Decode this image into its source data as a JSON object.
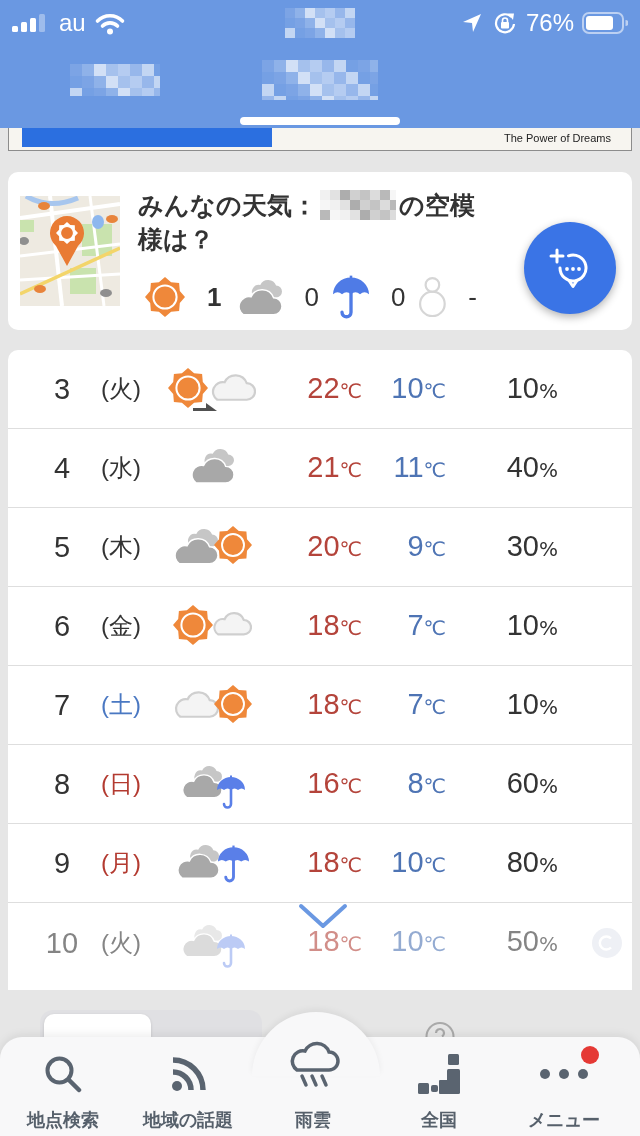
{
  "status_bar": {
    "carrier": "au",
    "battery": "76%"
  },
  "tabs": [
    {
      "selected": false
    },
    {
      "selected": true
    }
  ],
  "ad_banner": {
    "slogan": "The Power of Dreams"
  },
  "community_weather": {
    "title_start": "みんなの天気：",
    "title_end_lines": [
      "の空模",
      "様は？"
    ],
    "votes": [
      {
        "kind": "sunny",
        "count": "1",
        "leading": true
      },
      {
        "kind": "cloudy",
        "count": "0",
        "leading": false
      },
      {
        "kind": "rainy",
        "count": "0",
        "leading": false
      },
      {
        "kind": "snowy",
        "count": "-",
        "leading": false
      }
    ]
  },
  "forecast": {
    "collapsed": true,
    "rows": [
      {
        "date": "3",
        "weekday": "(火)",
        "color": "#333333",
        "kind": "sunny_then_cloudy",
        "high": {
          "value": "22",
          "unit": "℃"
        },
        "low": {
          "value": "10",
          "unit": "℃"
        },
        "precipitation": {
          "value": "10",
          "unit": "%"
        }
      },
      {
        "date": "4",
        "weekday": "(水)",
        "color": "#333333",
        "kind": "cloudy",
        "high": {
          "value": "21",
          "unit": "℃"
        },
        "low": {
          "value": "11",
          "unit": "℃"
        },
        "precipitation": {
          "value": "40",
          "unit": "%"
        }
      },
      {
        "date": "5",
        "weekday": "(木)",
        "color": "#333333",
        "kind": "cloudy_with_sun",
        "high": {
          "value": "20",
          "unit": "℃"
        },
        "low": {
          "value": "9",
          "unit": "℃"
        },
        "precipitation": {
          "value": "30",
          "unit": "%"
        }
      },
      {
        "date": "6",
        "weekday": "(金)",
        "color": "#333333",
        "kind": "sunny_with_clouds",
        "high": {
          "value": "18",
          "unit": "℃"
        },
        "low": {
          "value": "7",
          "unit": "℃"
        },
        "precipitation": {
          "value": "10",
          "unit": "%"
        }
      },
      {
        "date": "7",
        "weekday": "(土)",
        "color": "#4a78c2",
        "kind": "clouds_with_sun",
        "high": {
          "value": "18",
          "unit": "℃"
        },
        "low": {
          "value": "7",
          "unit": "℃"
        },
        "precipitation": {
          "value": "10",
          "unit": "%"
        }
      },
      {
        "date": "8",
        "weekday": "(日)",
        "color": "#b33a30",
        "kind": "cloudy_with_light_rain",
        "high": {
          "value": "16",
          "unit": "℃"
        },
        "low": {
          "value": "8",
          "unit": "℃"
        },
        "precipitation": {
          "value": "60",
          "unit": "%"
        }
      },
      {
        "date": "9",
        "weekday": "(月)",
        "color": "#b33a30",
        "kind": "cloudy_with_rain",
        "high": {
          "value": "18",
          "unit": "℃"
        },
        "low": {
          "value": "10",
          "unit": "℃"
        },
        "precipitation": {
          "value": "80",
          "unit": "%"
        }
      },
      {
        "date": "10",
        "weekday": "(火)",
        "color": "#858585",
        "kind": "cloudy_with_light_rain",
        "high": {
          "value": "18",
          "unit": "℃"
        },
        "low": {
          "value": "10",
          "unit": "℃"
        },
        "precipitation": {
          "value": "50",
          "unit": "%"
        }
      }
    ]
  },
  "range_tabs": [
    {
      "selected": true
    },
    {
      "selected": false
    }
  ],
  "nav": [
    {
      "kind": "search",
      "label": "地点検索",
      "badge": false
    },
    {
      "kind": "topics",
      "label": "地域の話題",
      "badge": false
    },
    {
      "kind": "rain_radar",
      "label": "雨雲",
      "badge": false
    },
    {
      "kind": "nationwide",
      "label": "全国",
      "badge": false
    },
    {
      "kind": "menu",
      "label": "メニュー",
      "badge": true
    }
  ]
}
